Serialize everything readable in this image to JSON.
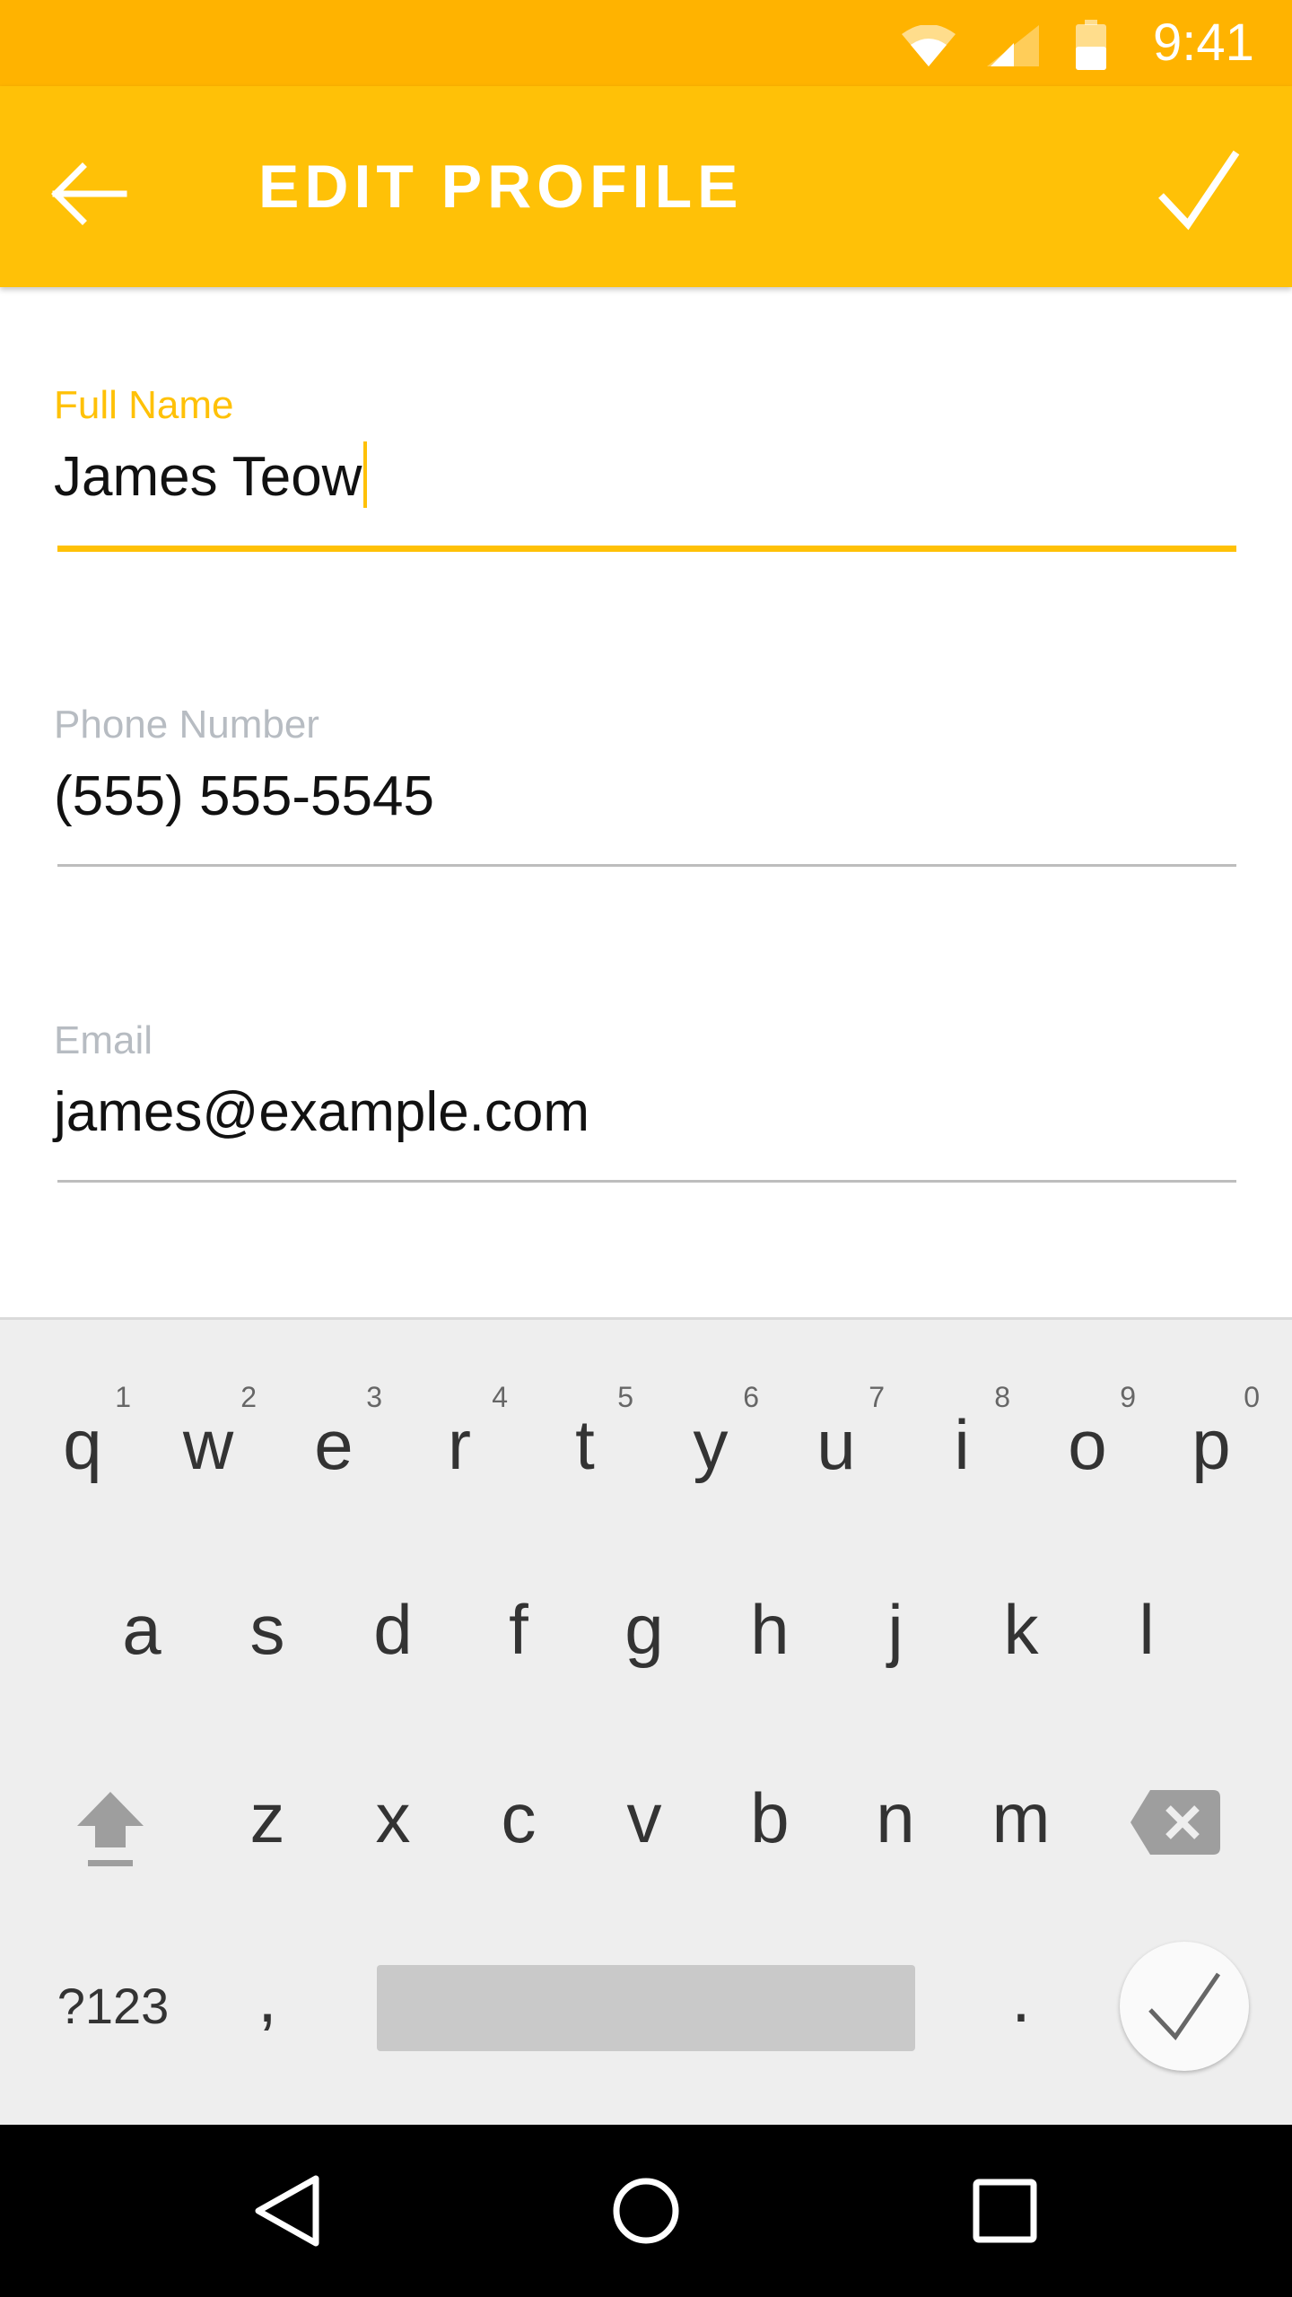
{
  "status_bar": {
    "time": "9:41",
    "icons": [
      "wifi-icon",
      "cell-signal-icon",
      "battery-icon"
    ]
  },
  "app_bar": {
    "title": "EDIT PROFILE",
    "back_icon": "arrow-left-icon",
    "save_icon": "checkmark-icon",
    "color": "#FFC107"
  },
  "form": {
    "fields": [
      {
        "label": "Full Name",
        "value": "James Teow",
        "focused": true
      },
      {
        "label": "Phone Number",
        "value": "(555) 555-5545",
        "focused": false
      },
      {
        "label": "Email",
        "value": "james@example.com",
        "focused": false
      }
    ]
  },
  "keyboard": {
    "row1": [
      "q",
      "w",
      "e",
      "r",
      "t",
      "y",
      "u",
      "i",
      "o",
      "p"
    ],
    "row1_hints": [
      "1",
      "2",
      "3",
      "4",
      "5",
      "6",
      "7",
      "8",
      "9",
      "0"
    ],
    "row2": [
      "a",
      "s",
      "d",
      "f",
      "g",
      "h",
      "j",
      "k",
      "l"
    ],
    "row3": [
      "z",
      "x",
      "c",
      "v",
      "b",
      "n",
      "m"
    ],
    "symbols_label": "?123",
    "comma": ",",
    "period": ".",
    "shift_icon": "shift-arrow-icon",
    "backspace_icon": "backspace-icon",
    "enter_icon": "checkmark-icon"
  },
  "nav_bar": {
    "icons": [
      "back-triangle-icon",
      "home-circle-icon",
      "recents-square-icon"
    ]
  },
  "colors": {
    "status_bar": "#FFB300",
    "accent": "#FFC107",
    "keyboard_bg": "#EEEEEE"
  }
}
